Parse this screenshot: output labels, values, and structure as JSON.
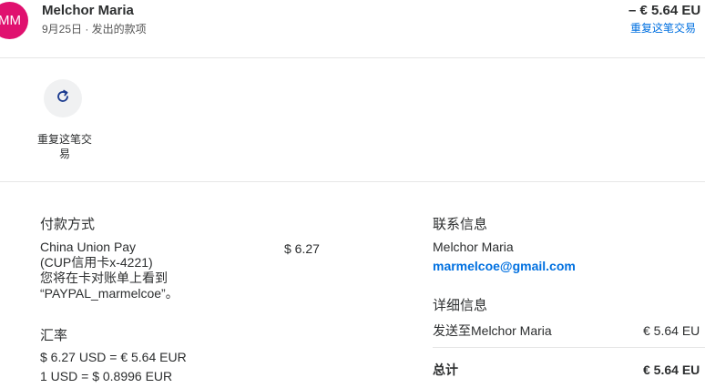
{
  "header": {
    "avatar_initials": "MM",
    "name": "Melchor Maria",
    "subline": "9月25日 · 发出的款项",
    "amount": "– € 5.64 EU",
    "repeat_link": "重复这笔交易"
  },
  "actions": {
    "repeat_label": "重复这笔交易",
    "repeat_icon": "refresh-icon"
  },
  "payment": {
    "title": "付款方式",
    "method_lines": [
      "China Union Pay",
      "(CUP信用卡x-4221)",
      "您将在卡对账单上看到",
      "“PAYPAL_marmelcoe”。"
    ],
    "amount": "$ 6.27"
  },
  "exchange": {
    "title": "汇率",
    "line1": "$ 6.27 USD = € 5.64 EUR",
    "line2": "1 USD = $ 0.8996 EUR"
  },
  "contact": {
    "title": "联系信息",
    "name": "Melchor Maria",
    "email": "marmelcoe@gmail.com"
  },
  "details": {
    "title": "详细信息",
    "sent_to": "发送至Melchor Maria",
    "sent_amount": "€ 5.64 EU",
    "total_label": "总计",
    "total_amount": "€ 5.64 EU"
  },
  "colors": {
    "accent": "#0070e0",
    "avatar_bg": "#e0116f"
  }
}
